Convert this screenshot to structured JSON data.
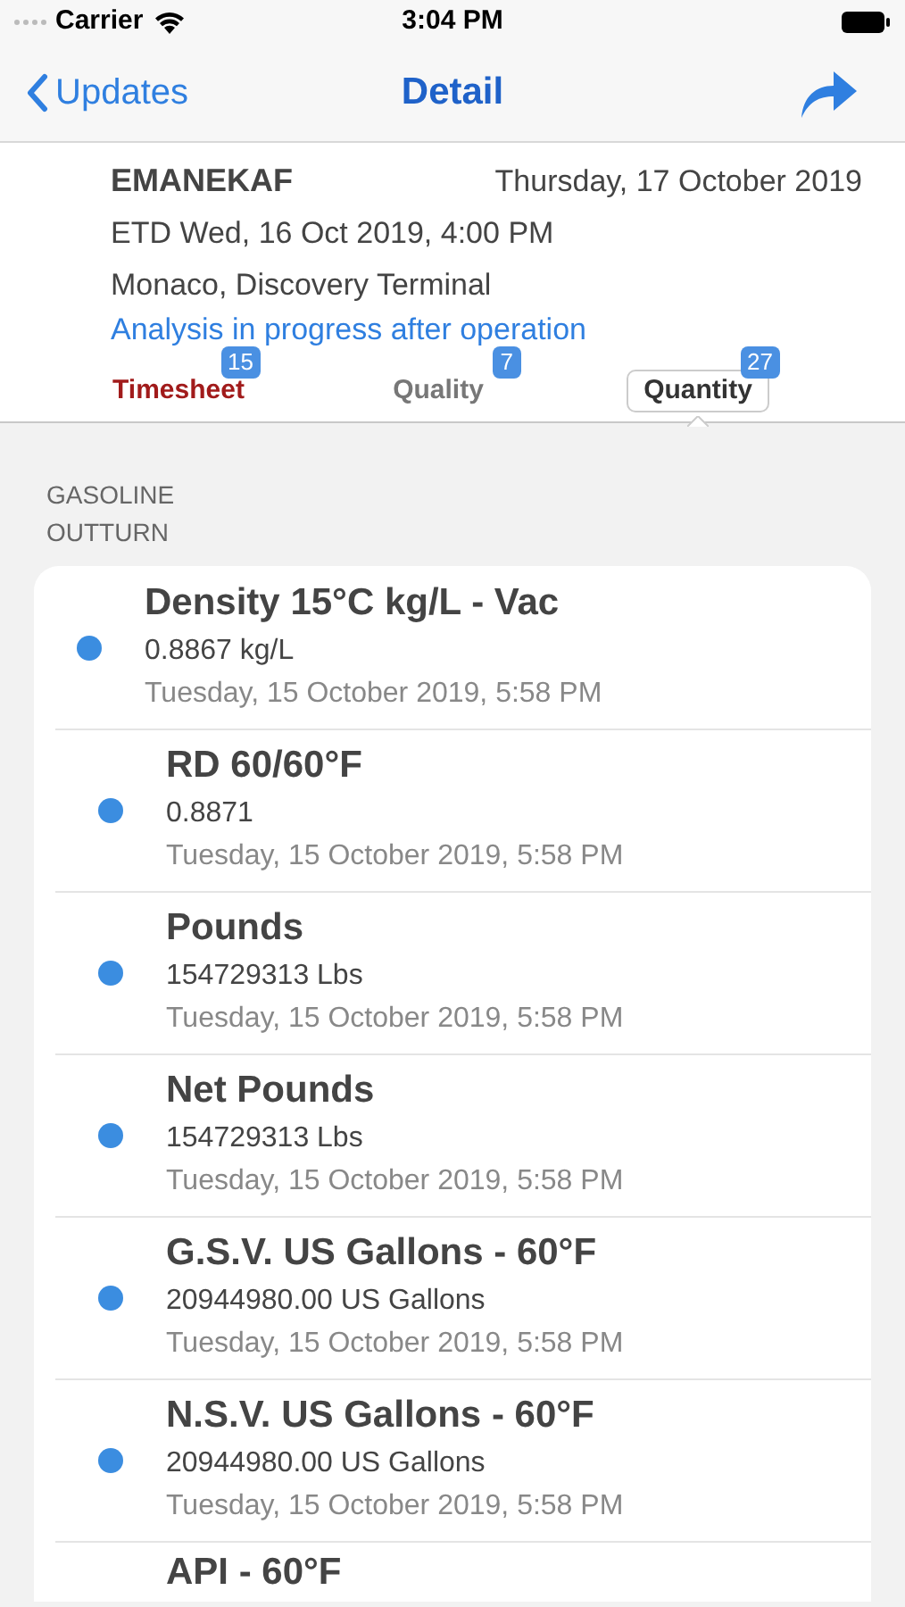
{
  "status_bar": {
    "carrier": "Carrier",
    "time": "3:04 PM"
  },
  "nav": {
    "back": "Updates",
    "title": "Detail"
  },
  "header": {
    "vessel": "EMANEKAF",
    "date": "Thursday, 17 October 2019",
    "etd": "ETD Wed, 16 Oct 2019, 4:00 PM",
    "location": "Monaco, Discovery Terminal",
    "status": "Analysis in progress after operation"
  },
  "tabs": [
    {
      "label": "Timesheet",
      "badge": "15",
      "selected": false,
      "alert": true
    },
    {
      "label": "Quality",
      "badge": "7",
      "selected": false,
      "alert": false
    },
    {
      "label": "Quantity",
      "badge": "27",
      "selected": true,
      "alert": false
    }
  ],
  "section": {
    "title_lines": [
      "GASOLINE",
      "OUTTURN"
    ]
  },
  "items": [
    {
      "title": "Density 15°C kg/L - Vac",
      "value": "0.8867 kg/L",
      "date": "Tuesday, 15 October 2019, 5:58 PM",
      "color": "#3b8de0"
    },
    {
      "title": "RD 60/60°F",
      "value": "0.8871",
      "date": "Tuesday, 15 October 2019, 5:58 PM",
      "color": "#3b8de0"
    },
    {
      "title": "Pounds",
      "value": "154729313 Lbs",
      "date": "Tuesday, 15 October 2019, 5:58 PM",
      "color": "#3b8de0"
    },
    {
      "title": "Net Pounds",
      "value": "154729313 Lbs",
      "date": "Tuesday, 15 October 2019, 5:58 PM",
      "color": "#3b8de0"
    },
    {
      "title": "G.S.V. US Gallons - 60°F",
      "value": "20944980.00 US Gallons",
      "date": "Tuesday, 15 October 2019, 5:58 PM",
      "color": "#3b8de0"
    },
    {
      "title": "N.S.V. US Gallons - 60°F",
      "value": "20944980.00 US Gallons",
      "date": "Tuesday, 15 October 2019, 5:58 PM",
      "color": "#3b8de0"
    },
    {
      "title": "API - 60°F"
    }
  ]
}
